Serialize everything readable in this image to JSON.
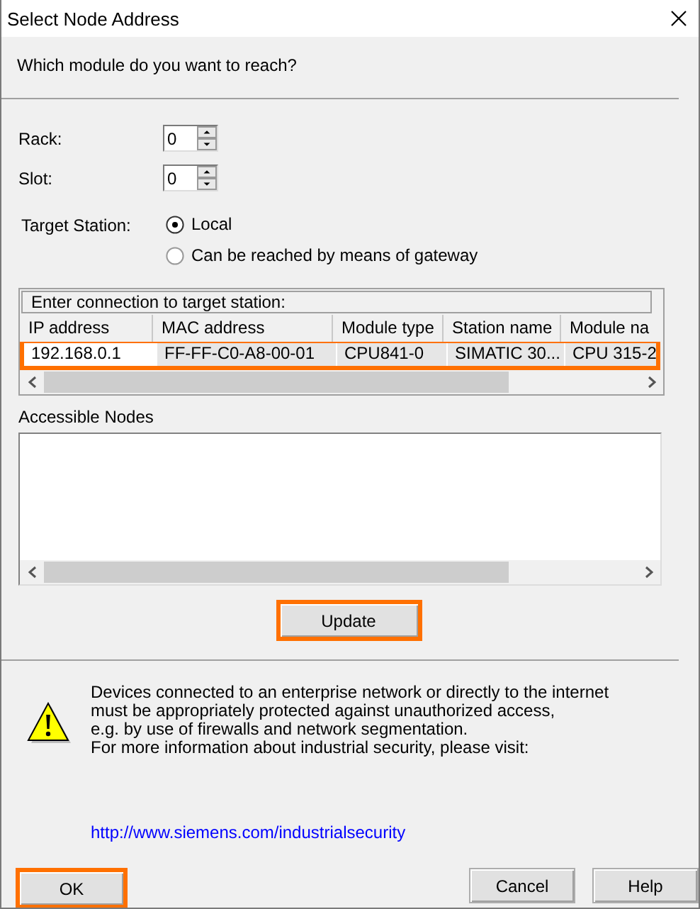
{
  "window": {
    "title": "Select Node Address"
  },
  "prompt": "Which module do you want to reach?",
  "rack": {
    "label": "Rack:",
    "value": "0"
  },
  "slot": {
    "label": "Slot:",
    "value": "0"
  },
  "target_station": {
    "label": "Target Station:",
    "options": [
      {
        "label": "Local",
        "selected": true
      },
      {
        "label": "Can be reached by means of gateway",
        "selected": false
      }
    ]
  },
  "connection_table": {
    "caption": "Enter connection to target station:",
    "columns": [
      "IP address",
      "MAC address",
      "Module type",
      "Station name",
      "Module na"
    ],
    "rows": [
      {
        "cells": [
          "192.168.0.1",
          "FF-FF-C0-A8-00-01",
          "CPU841-0",
          "SIMATIC 30...",
          "CPU 315-2"
        ],
        "highlighted": true
      }
    ]
  },
  "accessible_nodes": {
    "label": "Accessible Nodes"
  },
  "update_button": {
    "label": "Update",
    "highlighted": true
  },
  "security_notice": {
    "lines": [
      "Devices connected to an enterprise network or directly to the internet",
      "must be appropriately  protected against unauthorized access,",
      "e.g. by use of firewalls and network segmentation.",
      "For more information about industrial security, please visit:"
    ],
    "link": "http://www.siemens.com/industrialsecurity"
  },
  "buttons": [
    {
      "label": "OK",
      "highlighted": true
    },
    {
      "label": "Cancel",
      "highlighted": false
    },
    {
      "label": "Help",
      "highlighted": false
    }
  ]
}
